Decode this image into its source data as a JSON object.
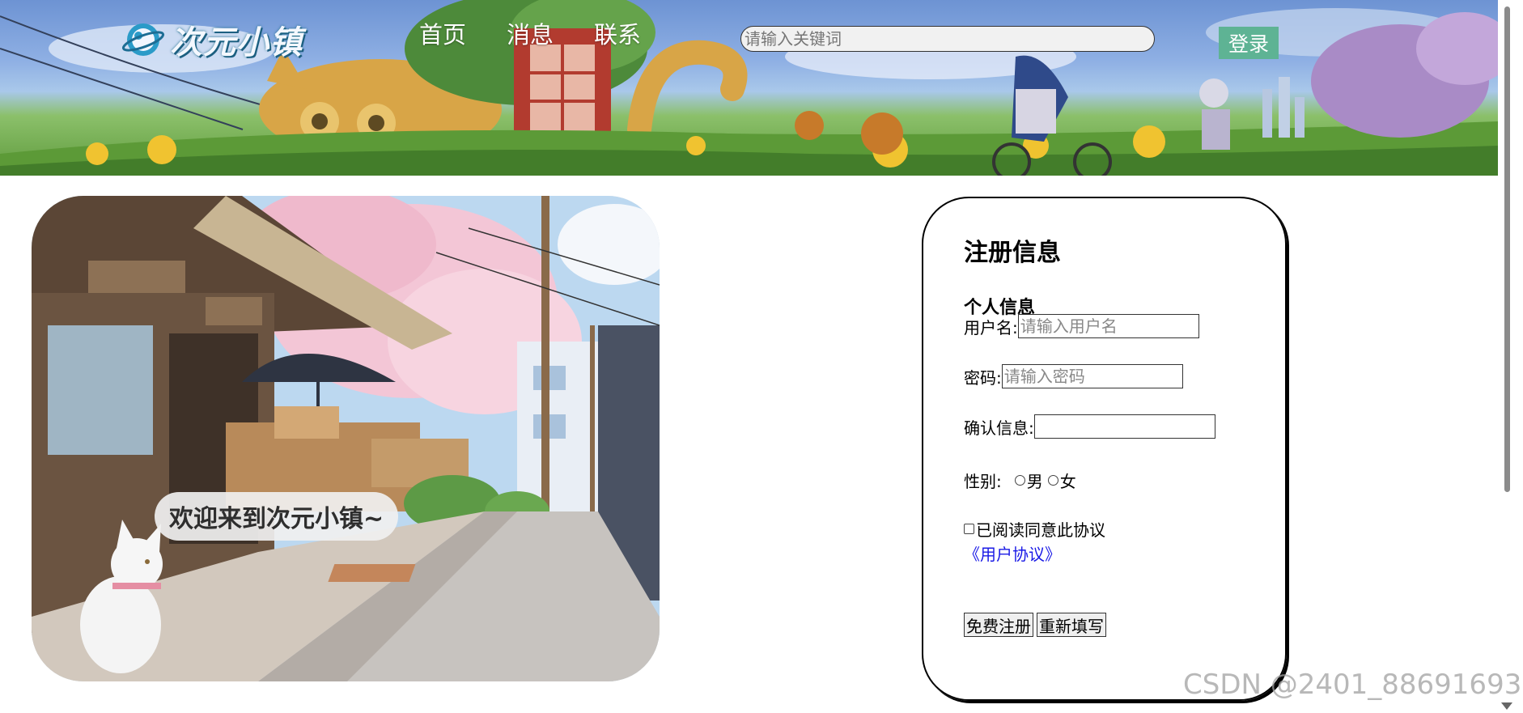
{
  "header": {
    "logo_text": "次元小镇",
    "nav": [
      "首页",
      "消息",
      "联系"
    ],
    "search_placeholder": "请输入关键词",
    "login_label": "登录"
  },
  "hero": {
    "welcome_text": "欢迎来到次元小镇~"
  },
  "register": {
    "title": "注册信息",
    "section_title": "个人信息",
    "username_label": "用户名:",
    "username_placeholder": "请输入用户名",
    "password_label": "密码:",
    "password_placeholder": "请输入密码",
    "confirm_label": "确认信息:",
    "gender_label": "性别:",
    "gender_male": "男",
    "gender_female": "女",
    "agree_label": "已阅读同意此协议",
    "agreement_link": "《用户协议》",
    "submit_label": "免费注册",
    "reset_label": "重新填写"
  },
  "watermark": "CSDN @2401_88691693",
  "colors": {
    "login_bg": "#5eb394",
    "link": "#1a1ae6"
  }
}
